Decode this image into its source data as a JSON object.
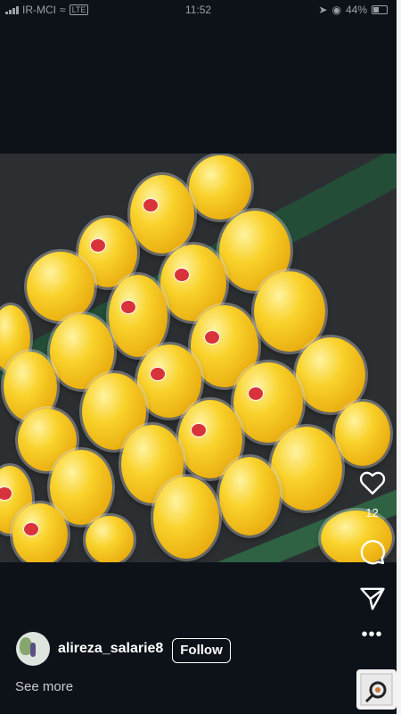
{
  "status_bar": {
    "carrier": "IR-MCI",
    "network": "LTE",
    "time": "11:52",
    "battery": "44%"
  },
  "post": {
    "likes": "12",
    "username": "alireza_salarie8",
    "follow_label": "Follow",
    "see_more_label": "See more"
  },
  "icons": {
    "heart": "heart-icon",
    "comment": "comment-icon",
    "share": "send-icon",
    "more": "more-horizontal-icon",
    "widget": "magnifier-icon"
  },
  "colors": {
    "background": "#0d1219",
    "text": "#ffffff",
    "secondary_text": "#c8ccd1"
  }
}
